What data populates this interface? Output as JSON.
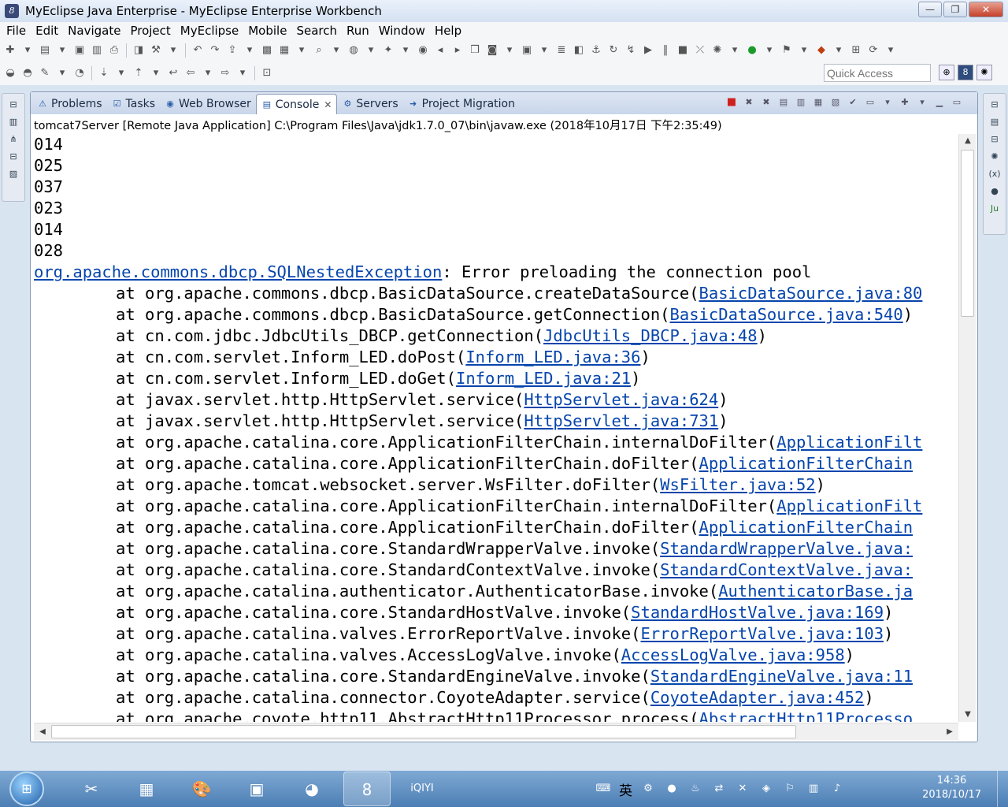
{
  "window": {
    "title": "MyEclipse Java Enterprise - MyEclipse Enterprise Workbench",
    "controls": {
      "minimize": "—",
      "maximize": "❐",
      "close": "✕"
    }
  },
  "menu": [
    "File",
    "Edit",
    "Navigate",
    "Project",
    "MyEclipse",
    "Mobile",
    "Search",
    "Run",
    "Window",
    "Help"
  ],
  "quick_access": {
    "placeholder": "Quick Access"
  },
  "tabs": [
    {
      "label": "Problems",
      "icon": "problems-icon",
      "glyph": "⚠"
    },
    {
      "label": "Tasks",
      "icon": "tasks-icon",
      "glyph": "☑"
    },
    {
      "label": "Web Browser",
      "icon": "globe-icon",
      "glyph": "◉"
    },
    {
      "label": "Console",
      "icon": "console-icon",
      "glyph": "▤",
      "active": true
    },
    {
      "label": "Servers",
      "icon": "servers-icon",
      "glyph": "⚙"
    },
    {
      "label": "Project Migration",
      "icon": "migration-icon",
      "glyph": "➜"
    }
  ],
  "console": {
    "process": "tomcat7Server [Remote Java Application] C:\\Program Files\\Java\\jdk1.7.0_07\\bin\\javaw.exe (2018年10月17日 下午2:35:49)",
    "output_lines": [
      "014",
      "025",
      "037",
      "023",
      "014",
      "028"
    ],
    "exception": {
      "class": "org.apache.commons.dbcp.SQLNestedException",
      "message": ": Error preloading the connection pool"
    },
    "stack": [
      {
        "method": "org.apache.commons.dbcp.BasicDataSource.createDataSource",
        "source": "BasicDataSource.java:80",
        "close": ""
      },
      {
        "method": "org.apache.commons.dbcp.BasicDataSource.getConnection",
        "source": "BasicDataSource.java:540",
        "close": ")"
      },
      {
        "method": "cn.com.jdbc.JdbcUtils_DBCP.getConnection",
        "source": "JdbcUtils_DBCP.java:48",
        "close": ")"
      },
      {
        "method": "cn.com.servlet.Inform_LED.doPost",
        "source": "Inform_LED.java:36",
        "close": ")"
      },
      {
        "method": "cn.com.servlet.Inform_LED.doGet",
        "source": "Inform_LED.java:21",
        "close": ")"
      },
      {
        "method": "javax.servlet.http.HttpServlet.service",
        "source": "HttpServlet.java:624",
        "close": ")"
      },
      {
        "method": "javax.servlet.http.HttpServlet.service",
        "source": "HttpServlet.java:731",
        "close": ")"
      },
      {
        "method": "org.apache.catalina.core.ApplicationFilterChain.internalDoFilter",
        "source": "ApplicationFilt",
        "close": ""
      },
      {
        "method": "org.apache.catalina.core.ApplicationFilterChain.doFilter",
        "source": "ApplicationFilterChain",
        "close": ""
      },
      {
        "method": "org.apache.tomcat.websocket.server.WsFilter.doFilter",
        "source": "WsFilter.java:52",
        "close": ")"
      },
      {
        "method": "org.apache.catalina.core.ApplicationFilterChain.internalDoFilter",
        "source": "ApplicationFilt",
        "close": ""
      },
      {
        "method": "org.apache.catalina.core.ApplicationFilterChain.doFilter",
        "source": "ApplicationFilterChain",
        "close": ""
      },
      {
        "method": "org.apache.catalina.core.StandardWrapperValve.invoke",
        "source": "StandardWrapperValve.java:",
        "close": ""
      },
      {
        "method": "org.apache.catalina.core.StandardContextValve.invoke",
        "source": "StandardContextValve.java:",
        "close": ""
      },
      {
        "method": "org.apache.catalina.authenticator.AuthenticatorBase.invoke",
        "source": "AuthenticatorBase.ja",
        "close": ""
      },
      {
        "method": "org.apache.catalina.core.StandardHostValve.invoke",
        "source": "StandardHostValve.java:169",
        "close": ")"
      },
      {
        "method": "org.apache.catalina.valves.ErrorReportValve.invoke",
        "source": "ErrorReportValve.java:103",
        "close": ")"
      },
      {
        "method": "org.apache.catalina.valves.AccessLogValve.invoke",
        "source": "AccessLogValve.java:958",
        "close": ")"
      },
      {
        "method": "org.apache.catalina.core.StandardEngineValve.invoke",
        "source": "StandardEngineValve.java:11",
        "close": ""
      },
      {
        "method": "org.apache.catalina.connector.CoyoteAdapter.service",
        "source": "CoyoteAdapter.java:452",
        "close": ")"
      },
      {
        "method": "org.apache.coyote.http11.AbstractHttp11Processor.process",
        "source": "AbstractHttp11Processo",
        "close": ""
      }
    ]
  },
  "taskbar": {
    "apps": [
      {
        "name": "snipping-tool-app",
        "glyph": "✂"
      },
      {
        "name": "calculator-app",
        "glyph": "▦"
      },
      {
        "name": "paint-app",
        "glyph": "🎨"
      },
      {
        "name": "control-panel-app",
        "glyph": "▣"
      },
      {
        "name": "firefox-app",
        "glyph": "◕"
      },
      {
        "name": "myeclipse-app",
        "glyph": "8",
        "active": true
      },
      {
        "name": "iqiyi-app",
        "glyph": "iQIYI"
      }
    ],
    "ime_text": "英",
    "clock_time": "14:36",
    "clock_date": "2018/10/17"
  },
  "colors": {
    "link": "#0645ad",
    "terminate": "#d0201e",
    "taskbar": "#4c7eb4"
  }
}
